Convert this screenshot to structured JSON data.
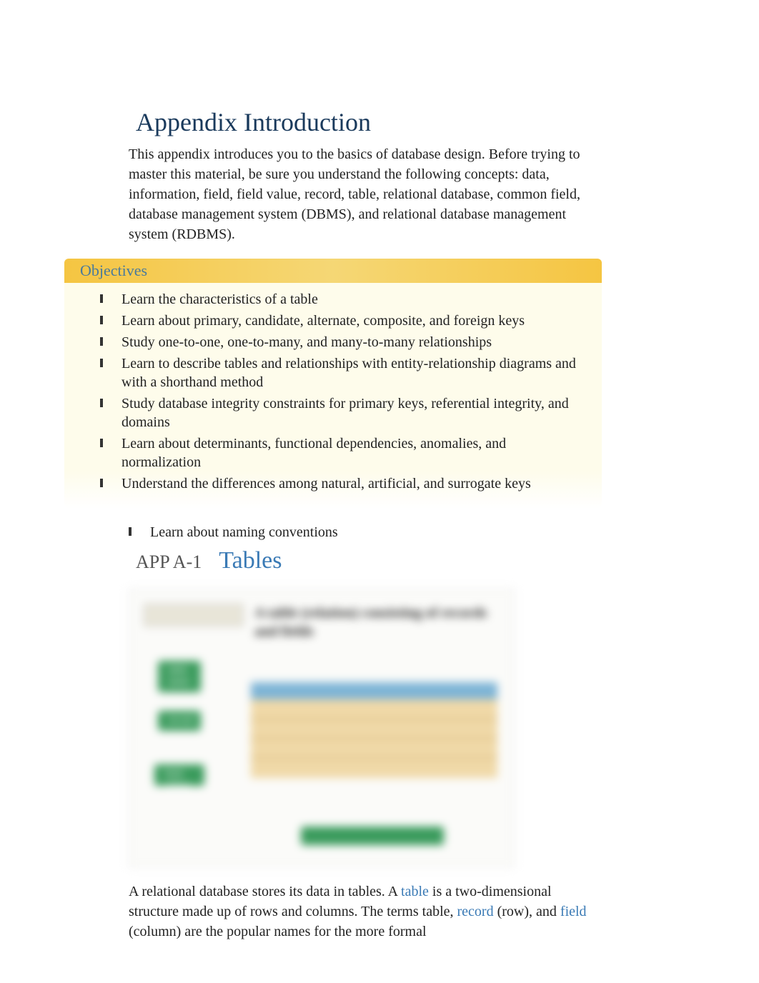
{
  "heading": "Appendix Introduction",
  "intro": "This appendix introduces you to the basics of database design. Before trying to master this material, be sure you understand the following concepts: data, information, field, field value, record, table, relational database, common field, database management system (DBMS), and relational database management system (RDBMS).",
  "objectives_label": "Objectives",
  "objectives": [
    "Learn the characteristics of a table",
    "Learn about primary, candidate, alternate, composite, and foreign keys",
    "Study one-to-one, one-to-many, and many-to-many relationships",
    "Learn to describe tables and relationships with entity-relationship diagrams and with a shorthand method",
    "Study database integrity constraints for primary keys, referential integrity, and domains",
    "Learn about determinants, functional dependencies, anomalies, and normalization",
    "Understand the differences among natural, artificial, and surrogate keys"
  ],
  "objective_last": "Learn about naming conventions",
  "section_number": "APP A-1",
  "section_title": "Tables",
  "figure": {
    "label": "Figure A-1",
    "caption": "A table (relation) consisting of records and fields",
    "callout1": "table name",
    "callout2": "record",
    "callout3": "field values",
    "bottom": "four records (rows)"
  },
  "para_parts": {
    "p1": "A relational database stores its data in tables. A ",
    "t1": "table",
    "p2": " is a two-dimensional structure made up of rows and columns. The terms table, ",
    "t2": "record",
    "p3": " (row), and ",
    "t3": "field",
    "p4": " (column) are the popular names for the more formal"
  }
}
